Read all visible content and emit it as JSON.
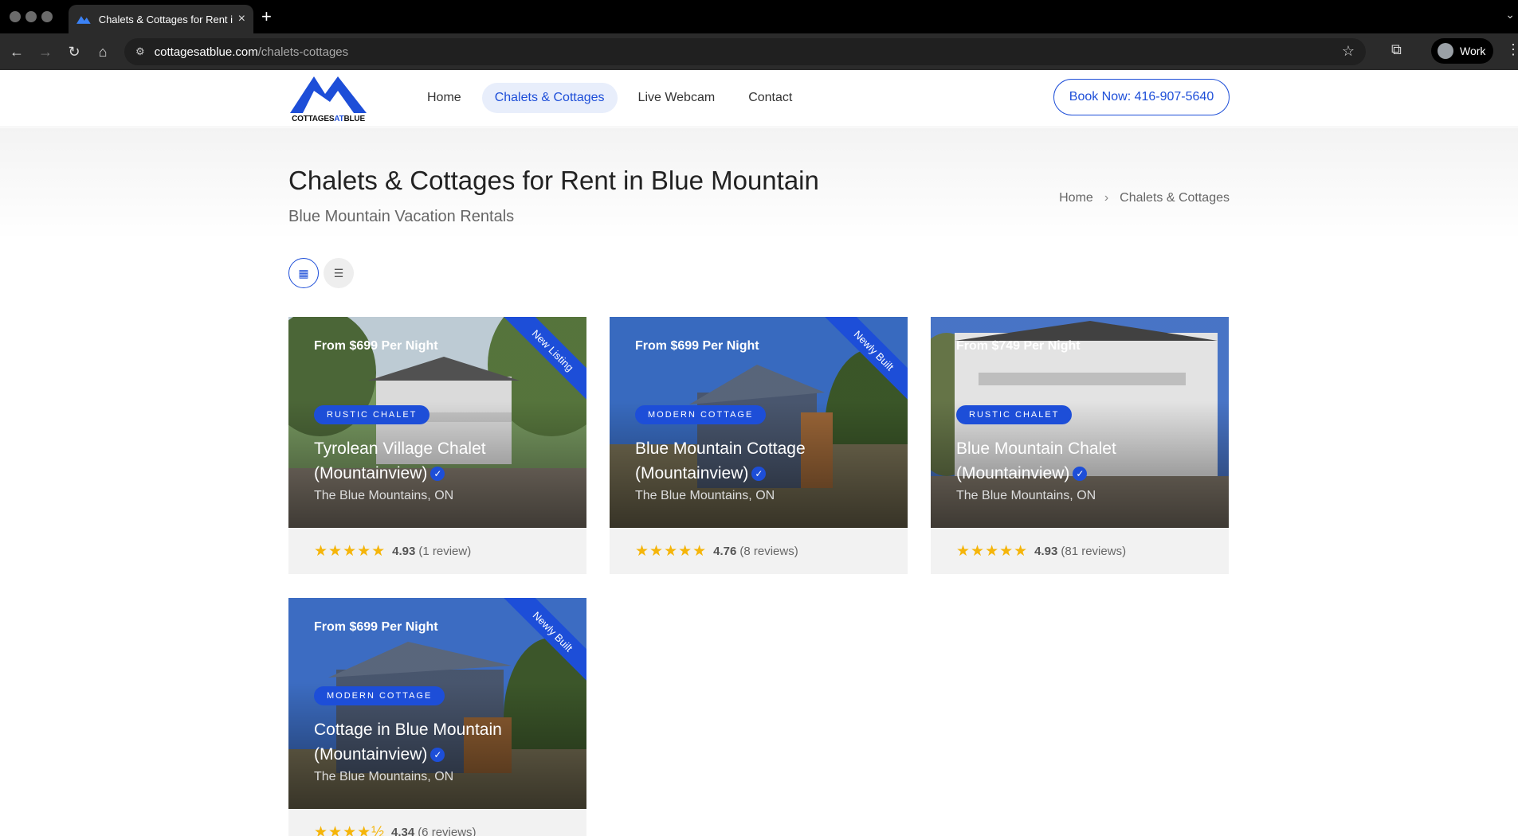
{
  "browser": {
    "tab_title": "Chalets & Cottages for Rent i",
    "url_host": "cottagesatblue.com",
    "url_path": "/chalets-cottages",
    "profile_name": "Work"
  },
  "site": {
    "logo_text_1": "COTTAGES",
    "logo_text_2": "AT",
    "logo_text_3": "BLUE",
    "nav": [
      "Home",
      "Chalets & Cottages",
      "Live Webcam",
      "Contact"
    ],
    "book_label": "Book Now: 416-907-5640",
    "accent": "#1d4ed8"
  },
  "hero": {
    "title": "Chalets & Cottages for Rent in Blue Mountain",
    "subtitle": "Blue Mountain Vacation Rentals",
    "breadcrumb": [
      "Home",
      "Chalets & Cottages"
    ]
  },
  "cards": [
    {
      "price": "From $699 Per Night",
      "ribbon": "New Listing",
      "tag": "RUSTIC CHALET",
      "title_line1": "Tyrolean Village Chalet",
      "title_line2": "(Mountainview)",
      "location": "The Blue Mountains, ON",
      "stars": "★★★★★",
      "score": "4.93",
      "reviews": "(1 review)"
    },
    {
      "price": "From $699 Per Night",
      "ribbon": "Newly Built",
      "tag": "MODERN COTTAGE",
      "title_line1": "Blue Mountain Cottage",
      "title_line2": "(Mountainview)",
      "location": "The Blue Mountains, ON",
      "stars": "★★★★★",
      "score": "4.76",
      "reviews": "(8 reviews)"
    },
    {
      "price": "From $749 Per Night",
      "ribbon": "",
      "tag": "RUSTIC CHALET",
      "title_line1": "Blue Mountain Chalet",
      "title_line2": "(Mountainview)",
      "location": "The Blue Mountains, ON",
      "stars": "★★★★★",
      "score": "4.93",
      "reviews": "(81 reviews)"
    },
    {
      "price": "From $699 Per Night",
      "ribbon": "Newly Built",
      "tag": "MODERN COTTAGE",
      "title_line1": "Cottage in Blue Mountain",
      "title_line2": "(Mountainview)",
      "location": "The Blue Mountains, ON",
      "stars": "★★★★½",
      "score": "4.34",
      "reviews": "(6 reviews)"
    }
  ]
}
